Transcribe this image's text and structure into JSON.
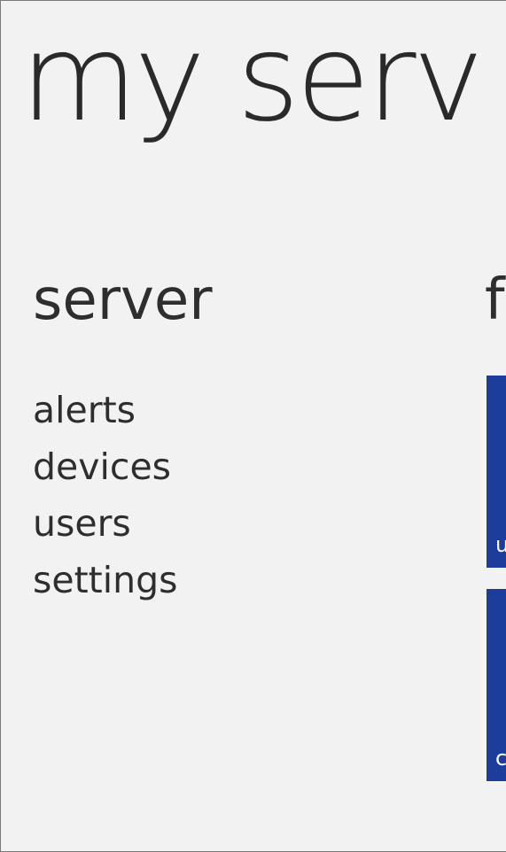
{
  "app": {
    "title": "my serv"
  },
  "sections": [
    {
      "heading": "server",
      "items": [
        {
          "label": "alerts"
        },
        {
          "label": "devices"
        },
        {
          "label": "users"
        },
        {
          "label": "settings"
        }
      ]
    },
    {
      "heading": "f",
      "tiles": [
        {
          "label": "u",
          "color": "#1d3d9c"
        },
        {
          "label": "c",
          "color": "#1d3d9c"
        }
      ]
    }
  ],
  "colors": {
    "background": "#f2f2f2",
    "text": "#2b2b2b",
    "tile": "#1d3d9c"
  }
}
